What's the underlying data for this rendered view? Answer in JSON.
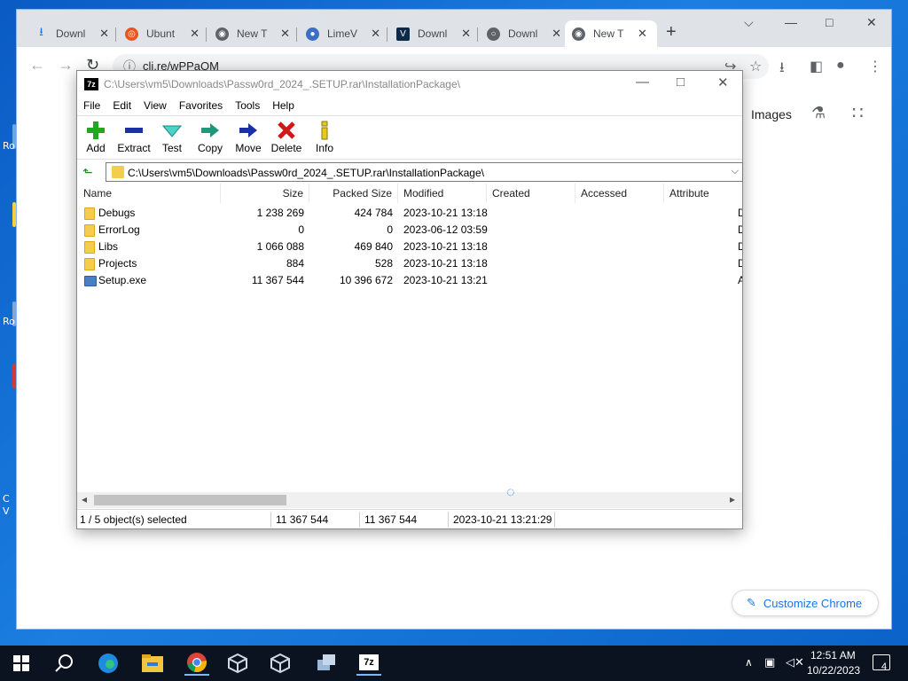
{
  "desktop": {
    "labels": [
      "Ro",
      "Ro",
      "C",
      "V"
    ]
  },
  "browser": {
    "tabs": [
      {
        "title": "Downl",
        "icon": "download-icon",
        "color": "#1a73e8"
      },
      {
        "title": "Ubunt",
        "icon": "ubuntu-icon",
        "color": "#e95420"
      },
      {
        "title": "New T",
        "icon": "chrome-icon",
        "color": "#5f6368"
      },
      {
        "title": "LimeV",
        "icon": "limewire-icon",
        "color": "#3a6fc4"
      },
      {
        "title": "Downl",
        "icon": "v-logo-icon",
        "color": "#0d2a4a"
      },
      {
        "title": "Downl",
        "icon": "globe-icon",
        "color": "#5f6368"
      },
      {
        "title": "New T",
        "icon": "chrome-icon",
        "color": "#5f6368"
      }
    ],
    "active_tab": 6,
    "url": "cli.re/wPPaOM",
    "google_images": "Images",
    "customize_label": "Customize Chrome"
  },
  "sevenzip": {
    "title": "C:\\Users\\vm5\\Downloads\\Passw0rd_2024_.SETUP.rar\\InstallationPackage\\",
    "logo": "7z",
    "menu": [
      "File",
      "Edit",
      "View",
      "Favorites",
      "Tools",
      "Help"
    ],
    "toolbar": [
      {
        "label": "Add",
        "icon": "add-icon"
      },
      {
        "label": "Extract",
        "icon": "extract-icon"
      },
      {
        "label": "Test",
        "icon": "test-icon"
      },
      {
        "label": "Copy",
        "icon": "copy-icon"
      },
      {
        "label": "Move",
        "icon": "move-icon"
      },
      {
        "label": "Delete",
        "icon": "delete-icon"
      },
      {
        "label": "Info",
        "icon": "info-icon"
      }
    ],
    "address": "C:\\Users\\vm5\\Downloads\\Passw0rd_2024_.SETUP.rar\\InstallationPackage\\",
    "columns": [
      "Name",
      "Size",
      "Packed Size",
      "Modified",
      "Created",
      "Accessed",
      "Attribute"
    ],
    "rows": [
      {
        "name": "Debugs",
        "size": "1 238 269",
        "packed": "424 784",
        "modified": "2023-10-21 13:18",
        "attr": "D",
        "type": "folder"
      },
      {
        "name": "ErrorLog",
        "size": "0",
        "packed": "0",
        "modified": "2023-06-12 03:59",
        "attr": "D",
        "type": "folder"
      },
      {
        "name": "Libs",
        "size": "1 066 088",
        "packed": "469 840",
        "modified": "2023-10-21 13:18",
        "attr": "D",
        "type": "folder"
      },
      {
        "name": "Projects",
        "size": "884",
        "packed": "528",
        "modified": "2023-10-21 13:18",
        "attr": "D",
        "type": "folder"
      },
      {
        "name": "Setup.exe",
        "size": "11 367 544",
        "packed": "10 396 672",
        "modified": "2023-10-21 13:21",
        "attr": "A",
        "type": "exe"
      }
    ],
    "status": {
      "selected": "1 / 5 object(s) selected",
      "size": "11 367 544",
      "packed": "11 367 544",
      "modified": "2023-10-21 13:21:29"
    }
  },
  "taskbar": {
    "time": "12:51 AM",
    "date": "10/22/2023",
    "notifications": "4",
    "sevenzip_label": "7z"
  }
}
